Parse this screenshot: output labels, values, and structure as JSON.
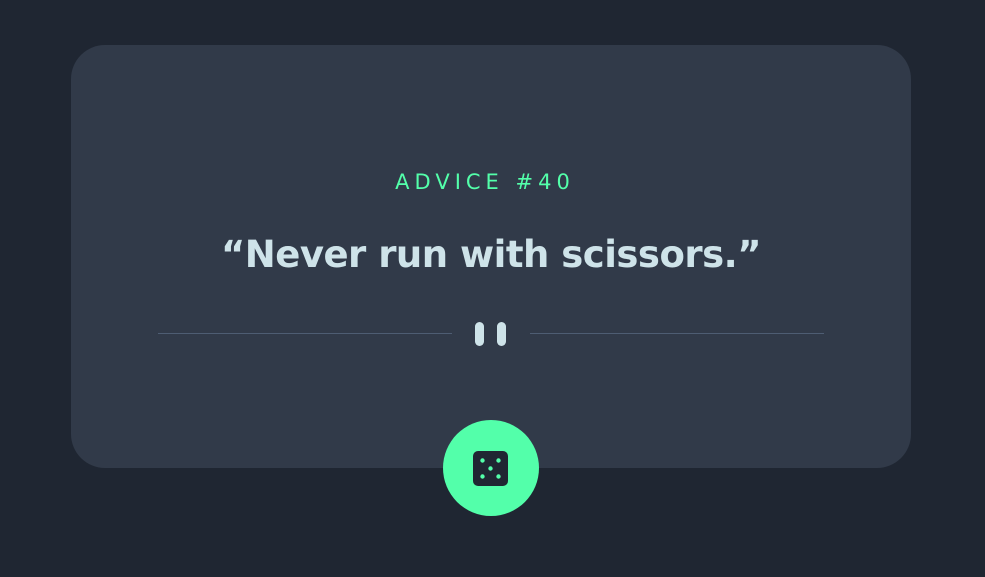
{
  "advice": {
    "label": "ADVICE #40",
    "text": "“Never run with scissors.”"
  },
  "divider": {
    "icon": "pause-icon"
  },
  "dice_button": {
    "icon": "dice-icon"
  },
  "colors": {
    "background": "#1f2632",
    "card": "#313a49",
    "accent": "#53ffaa",
    "text": "#cee3e9",
    "divider": "#4e5d73"
  }
}
